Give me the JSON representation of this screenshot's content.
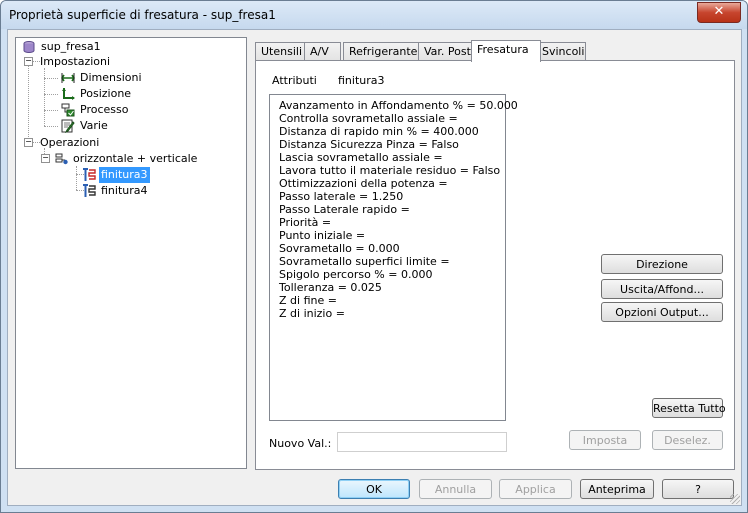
{
  "window": {
    "title": "Proprietà superficie di fresatura - sup_fresa1",
    "close_glyph": "✕"
  },
  "tree": {
    "root": "sup_fresa1",
    "impostazioni": "Impostazioni",
    "dimensioni": "Dimensioni",
    "posizione": "Posizione",
    "processo": "Processo",
    "varie": "Varie",
    "operazioni": "Operazioni",
    "orizzontale": "orizzontale + verticale",
    "finitura3": "finitura3",
    "finitura4": "finitura4",
    "selected": "finitura3"
  },
  "tabs": {
    "utensili": "Utensili",
    "av": "A/V",
    "refrigerante": "Refrigerante",
    "varpost": "Var. Post",
    "fresatura": "Fresatura",
    "svincoli": "Svincoli",
    "active": "Fresatura"
  },
  "panel": {
    "attributi_label": "Attributi",
    "attributi_value": "finitura3",
    "lines": [
      "Avanzamento in Affondamento % = 50.000",
      "Controlla sovrametallo assiale =",
      "Distanza di rapido min % = 400.000",
      "Distanza Sicurezza Pinza = Falso",
      "Lascia sovrametallo assiale =",
      "Lavora tutto il materiale residuo = Falso",
      "Ottimizzazioni della potenza =",
      "Passo laterale = 1.250",
      "Passo Laterale rapido =",
      "Priorità =",
      "Punto iniziale =",
      "Sovrametallo = 0.000",
      "Sovrametallo superfici limite =",
      "Spigolo percorso % = 0.000",
      "Tolleranza = 0.025",
      "Z di fine =",
      "Z di inizio ="
    ],
    "direzione": "Direzione",
    "uscita": "Uscita/Affond...",
    "opzioni": "Opzioni Output...",
    "resetta": "Resetta Tutto",
    "nuovo_label": "Nuovo Val.:",
    "nuovo_value": "",
    "imposta": "Imposta",
    "deselez": "Deselez."
  },
  "footer": {
    "ok": "OK",
    "annulla": "Annulla",
    "applica": "Applica",
    "anteprima": "Anteprima",
    "help": "?"
  },
  "colors": {
    "selection": "#3399ff",
    "close_button": "#c7452e",
    "window_frame": "#cfe0f2"
  }
}
